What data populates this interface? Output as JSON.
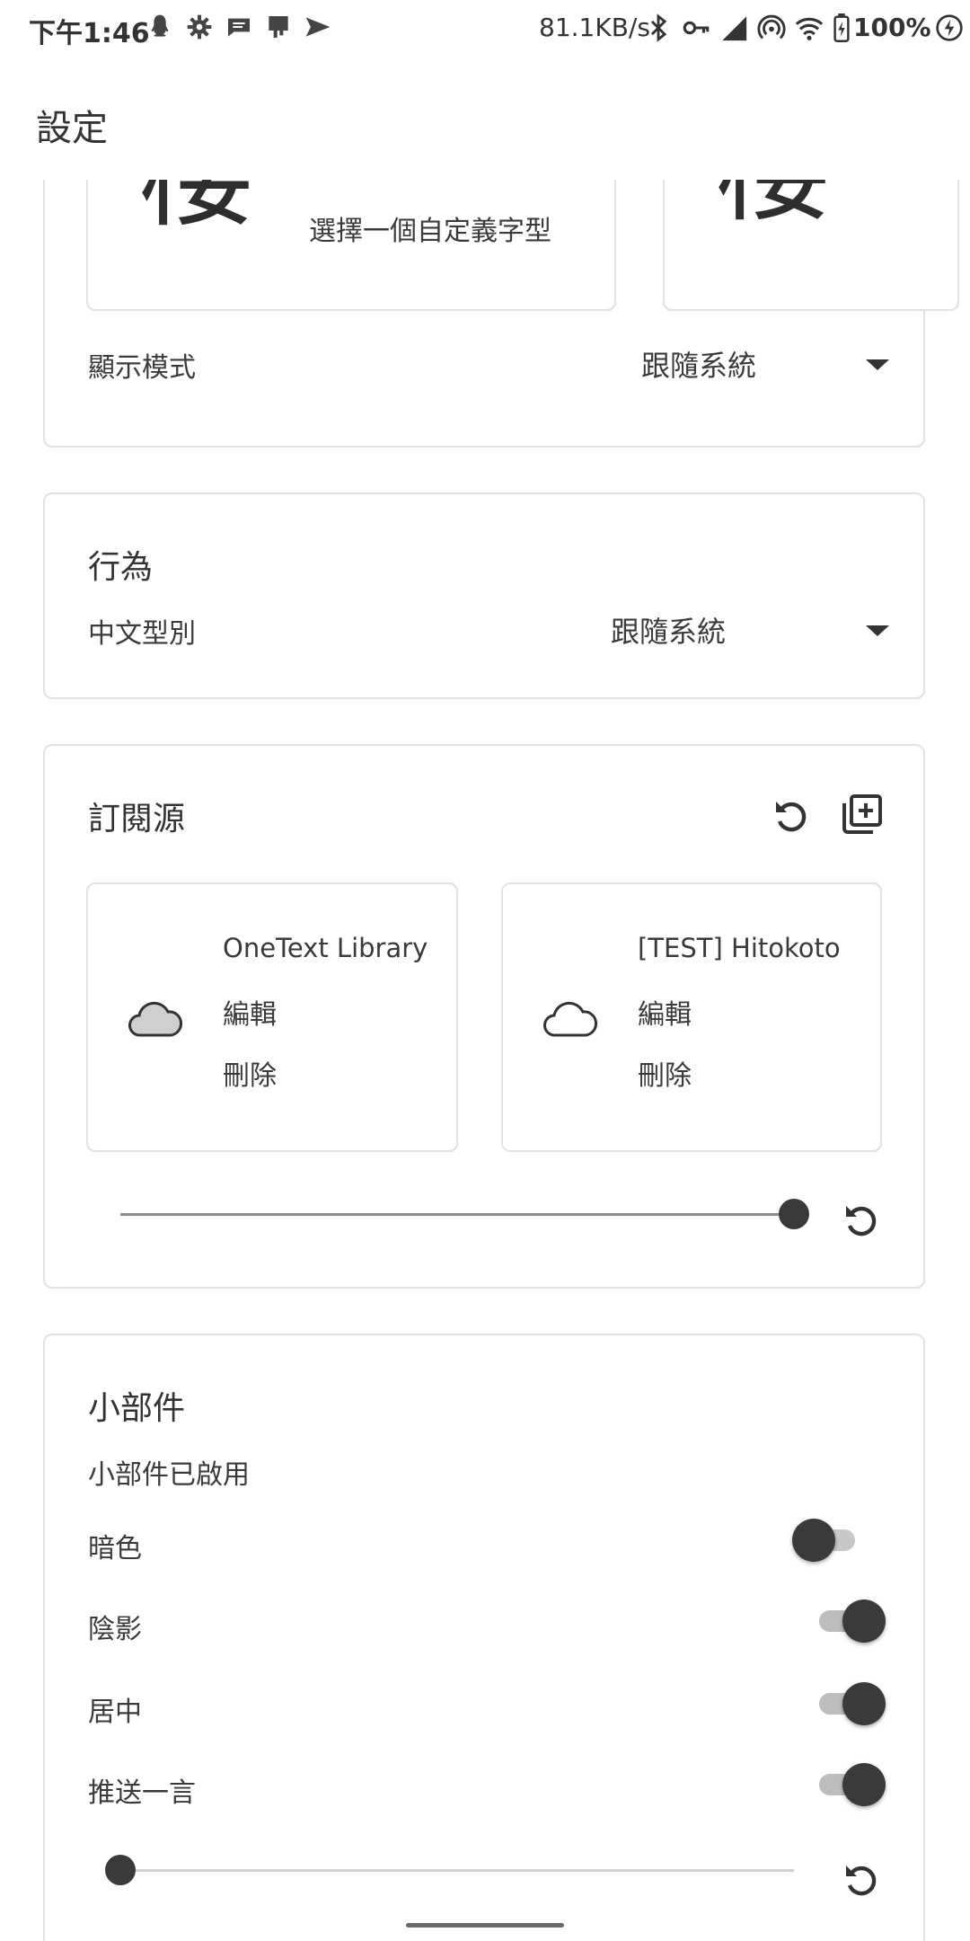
{
  "status_bar": {
    "time": "下午1:46",
    "net_speed": "81.1KB/s",
    "battery": "100%",
    "left_icons": [
      "qq-icon",
      "settings-gear-icon",
      "message-icon",
      "cast-icon",
      "send-icon"
    ],
    "right_icons": [
      "bluetooth-icon",
      "vpn-key-icon",
      "hd-signal-icon",
      "hotspot-icon",
      "wifi-icon"
    ]
  },
  "app_bar": {
    "title": "設定"
  },
  "appearance_card": {
    "font_options": [
      {
        "glyph": "楼",
        "label": "選擇一個自定義字型"
      },
      {
        "glyph": "楼",
        "label": ""
      }
    ],
    "display_mode": {
      "label": "顯示模式",
      "value": "跟隨系統"
    }
  },
  "behavior_card": {
    "title": "行為",
    "chinese_variant": {
      "label": "中文型別",
      "value": "跟隨系統"
    }
  },
  "sources_card": {
    "title": "訂閱源",
    "sources": [
      {
        "name": "OneText Library",
        "edit": "編輯",
        "delete": "刪除"
      },
      {
        "name": "[TEST] Hitokoto",
        "edit": "編輯",
        "delete": "刪除"
      }
    ],
    "slider_value_fraction": 1.0
  },
  "widget_card": {
    "title": "小部件",
    "status": "小部件已啟用",
    "toggles": [
      {
        "label": "暗色",
        "on": false
      },
      {
        "label": "陰影",
        "on": true
      },
      {
        "label": "居中",
        "on": true
      },
      {
        "label": "推送一言",
        "on": true
      }
    ],
    "slider_value_fraction": 0.0
  }
}
